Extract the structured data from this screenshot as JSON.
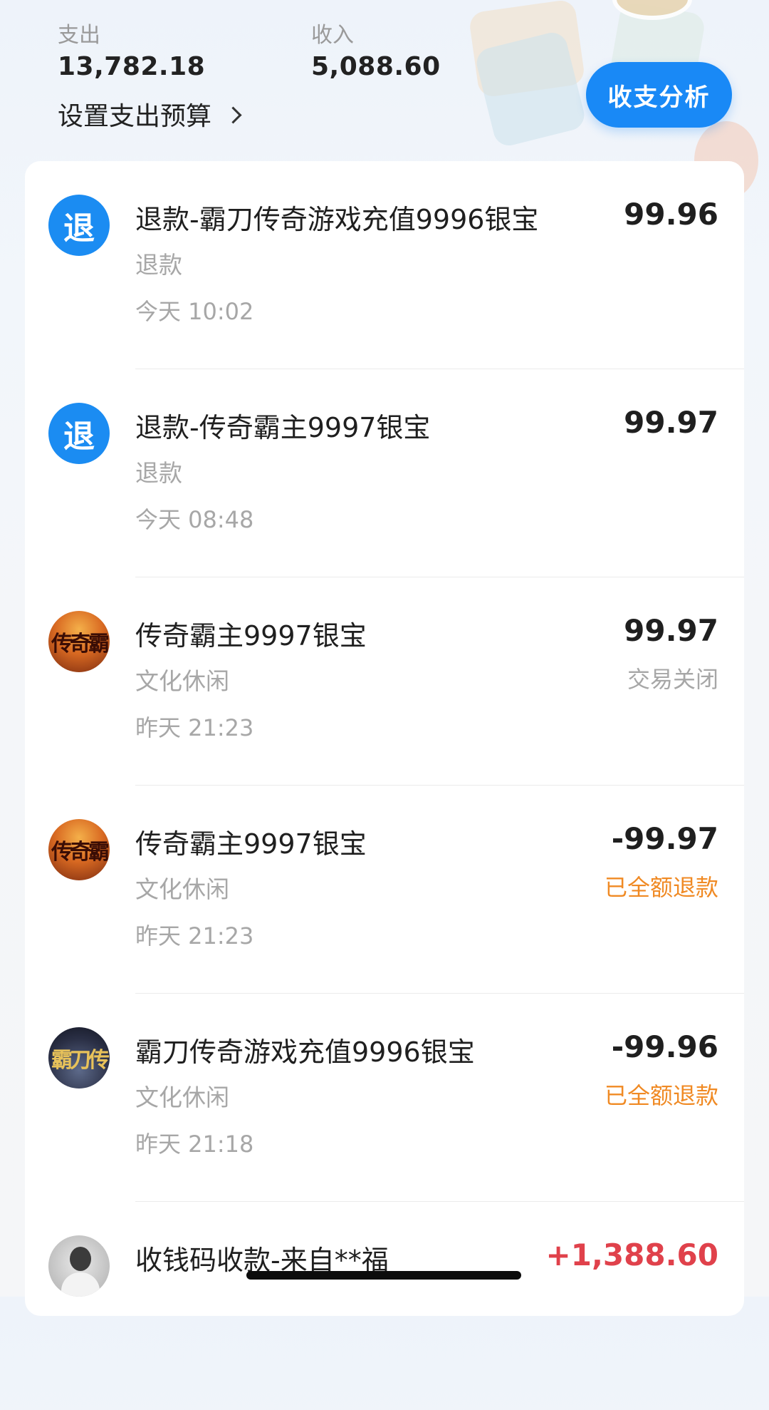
{
  "summary": {
    "expense_label": "支出",
    "expense_value": "13,782.18",
    "income_label": "收入",
    "income_value": "5,088.60",
    "budget_link": "设置支出预算",
    "analysis_button": "收支分析"
  },
  "transactions": [
    {
      "avatar_text": "退",
      "avatar_type": "refund-icon",
      "title": "退款-霸刀传奇游戏充值9996银宝",
      "category": "退款",
      "time": "今天 10:02",
      "amount": "99.96",
      "status": ""
    },
    {
      "avatar_text": "退",
      "avatar_type": "refund-icon",
      "title": "退款-传奇霸主9997银宝",
      "category": "退款",
      "time": "今天 08:48",
      "amount": "99.97",
      "status": ""
    },
    {
      "avatar_text": "传奇霸",
      "avatar_type": "merchant-logo",
      "title": "传奇霸主9997银宝",
      "category": "文化休闲",
      "time": "昨天 21:23",
      "amount": "99.97",
      "status": "交易关闭"
    },
    {
      "avatar_text": "传奇霸",
      "avatar_type": "merchant-logo",
      "title": "传奇霸主9997银宝",
      "category": "文化休闲",
      "time": "昨天 21:23",
      "amount": "-99.97",
      "status": "已全额退款"
    },
    {
      "avatar_text": "霸刀传",
      "avatar_type": "merchant-logo",
      "title": "霸刀传奇游戏充值9996银宝",
      "category": "文化休闲",
      "time": "昨天 21:18",
      "amount": "-99.96",
      "status": "已全额退款"
    },
    {
      "avatar_text": "",
      "avatar_type": "user-avatar",
      "title": "收钱码收款-来自**福",
      "category": "",
      "time": "",
      "amount": "+1,388.60",
      "status": ""
    }
  ],
  "colors": {
    "accent_blue": "#1989f6",
    "refund_status_orange": "#f08a24",
    "income_red": "#e0414b",
    "secondary_text": "#a7a7a7"
  }
}
